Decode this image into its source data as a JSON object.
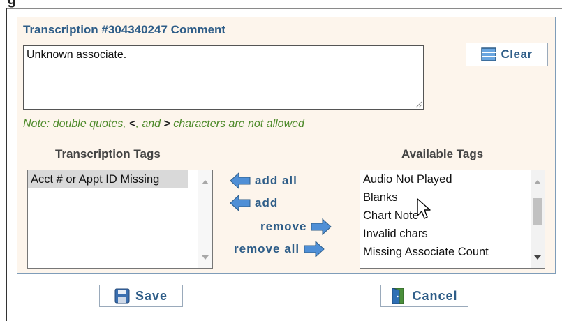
{
  "comment_section": {
    "title": "Transcription #304340247 Comment",
    "value": "Unknown associate.",
    "clear_label": "Clear",
    "note_prefix": "Note: double quotes, ",
    "note_lt": "<",
    "note_mid": ", and ",
    "note_gt": ">",
    "note_suffix": " characters are not allowed"
  },
  "transcription_tags": {
    "heading": "Transcription Tags",
    "items": [
      "Acct # or Appt ID Missing"
    ]
  },
  "available_tags": {
    "heading": "Available Tags",
    "items": [
      "Audio Not Played",
      "Blanks",
      "Chart Note",
      "Invalid chars",
      "Missing Associate Count"
    ]
  },
  "actions": {
    "add_all": "add all",
    "add": "add",
    "remove": "remove",
    "remove_all": "remove all"
  },
  "buttons": {
    "save": "Save",
    "cancel": "Cancel"
  },
  "colors": {
    "accent": "#2e5d88",
    "note": "#4d8a2a",
    "panel_bg": "#fdf5ec",
    "arrow": "#4f8fd6"
  },
  "icons": [
    "clear-icon",
    "arrow-left-icon",
    "arrow-right-icon",
    "save-icon",
    "cancel-icon",
    "cursor-icon"
  ]
}
